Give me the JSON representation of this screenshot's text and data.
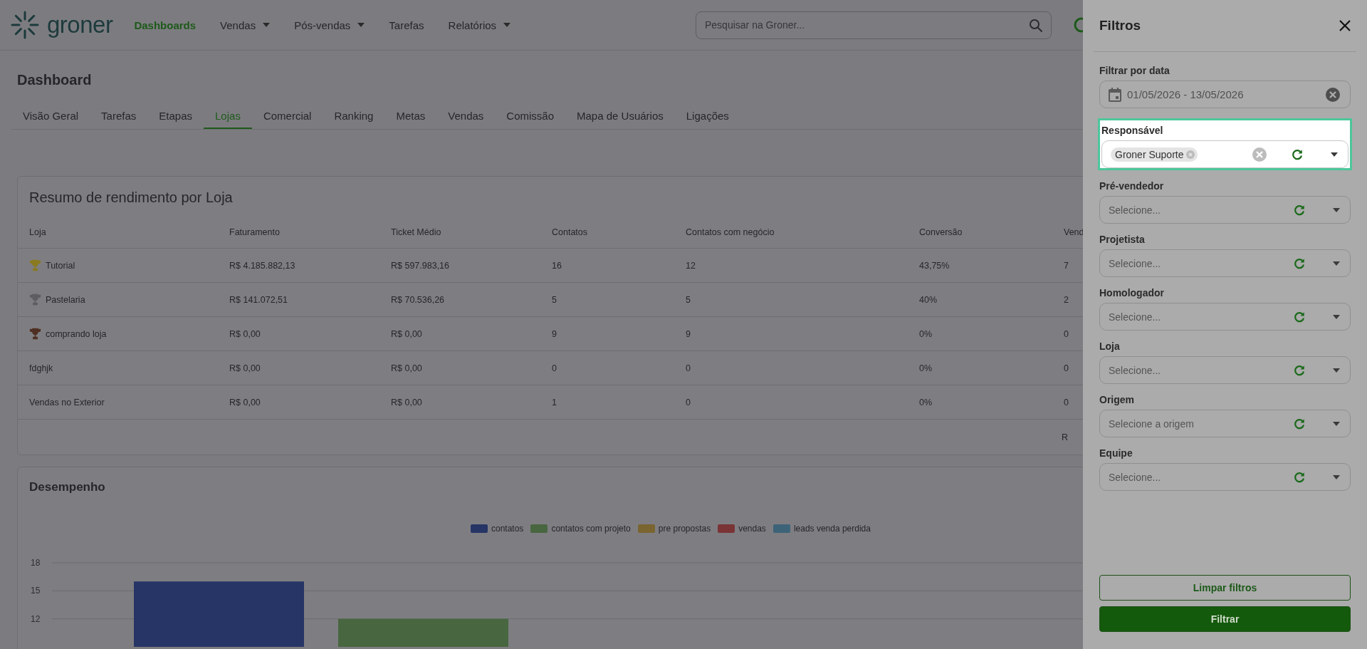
{
  "header": {
    "logo_text": "groner",
    "nav": [
      {
        "label": "Dashboards",
        "selected": true,
        "dropdown": false
      },
      {
        "label": "Vendas",
        "selected": false,
        "dropdown": true
      },
      {
        "label": "Pós-vendas",
        "selected": false,
        "dropdown": true
      },
      {
        "label": "Tarefas",
        "selected": false,
        "dropdown": false
      },
      {
        "label": "Relatórios",
        "selected": false,
        "dropdown": true
      }
    ],
    "search": {
      "placeholder": "Pesquisar na Groner..."
    }
  },
  "page_title": "Dashboard",
  "tabs": [
    {
      "label": "Visão Geral",
      "selected": false
    },
    {
      "label": "Tarefas",
      "selected": false
    },
    {
      "label": "Etapas",
      "selected": false
    },
    {
      "label": "Lojas",
      "selected": true
    },
    {
      "label": "Comercial",
      "selected": false
    },
    {
      "label": "Ranking",
      "selected": false
    },
    {
      "label": "Metas",
      "selected": false
    },
    {
      "label": "Vendas",
      "selected": false
    },
    {
      "label": "Comissão",
      "selected": false
    },
    {
      "label": "Mapa de Usuários",
      "selected": false
    },
    {
      "label": "Ligações",
      "selected": false
    }
  ],
  "summary_table": {
    "title": "Resumo de rendimento por Loja",
    "columns": [
      "Loja",
      "Faturamento",
      "Ticket Médio",
      "Contatos",
      "Contatos com negócio",
      "Conversão",
      "Vend"
    ],
    "rows": [
      {
        "color": "#8a7a20",
        "cells": [
          "Tutorial",
          "R$ 4.185.882,13",
          "R$ 597.983,16",
          "16",
          "12",
          "43,75%",
          "7"
        ]
      },
      {
        "color": "#5e5e62",
        "cells": [
          "Pastelaria",
          "R$ 141.072,51",
          "R$ 70.536,26",
          "5",
          "5",
          "40%",
          "2"
        ]
      },
      {
        "color": "#4e2f22",
        "cells": [
          "comprando loja",
          "R$ 0,00",
          "R$ 0,00",
          "9",
          "9",
          "0%",
          "0"
        ]
      },
      {
        "cells": [
          "fdghjk",
          "R$ 0,00",
          "R$ 0,00",
          "0",
          "0",
          "0%",
          "0"
        ]
      },
      {
        "cells": [
          "Vendas no Exterior",
          "R$ 0,00",
          "R$ 0,00",
          "1",
          "0",
          "0%",
          "0"
        ]
      }
    ],
    "footer_text": "R"
  },
  "performance": {
    "title": "Desempenho",
    "chart_data": {
      "type": "bar",
      "yticks": [
        12,
        15,
        18
      ],
      "ylim": [
        9,
        18
      ],
      "grid": true,
      "series": [
        {
          "name": "contatos",
          "color": "#263565",
          "values": [
            16
          ]
        },
        {
          "name": "contatos com projeto",
          "color": "#486640",
          "values": [
            12
          ]
        },
        {
          "name": "pre propostas",
          "color": "#7a6530",
          "values": [
            null
          ]
        },
        {
          "name": "vendas",
          "color": "#7a3436",
          "values": [
            null
          ]
        },
        {
          "name": "leads venda perdida",
          "color": "#3d6378",
          "values": [
            null
          ]
        }
      ]
    }
  },
  "drawer": {
    "title": "Filtros",
    "filters": [
      {
        "kind": "date",
        "label": "Filtrar por data",
        "value": "01/05/2026 - 13/05/2026",
        "focused": false
      },
      {
        "kind": "select",
        "label": "Responsável",
        "chips": [
          "Groner Suporte"
        ],
        "clearable": true,
        "focused": true
      },
      {
        "kind": "select",
        "label": "Pré-vendedor",
        "placeholder": "Selecione...",
        "focused": false
      },
      {
        "kind": "select",
        "label": "Projetista",
        "placeholder": "Selecione...",
        "focused": false
      },
      {
        "kind": "select",
        "label": "Homologador",
        "placeholder": "Selecione...",
        "focused": false
      },
      {
        "kind": "select",
        "label": "Loja",
        "placeholder": "Selecione...",
        "focused": false
      },
      {
        "kind": "select",
        "label": "Origem",
        "placeholder": "Selecione a origem",
        "focused": false
      },
      {
        "kind": "select",
        "label": "Equipe",
        "placeholder": "Selecione...",
        "focused": false
      }
    ],
    "buttons": [
      {
        "label": "Limpar filtros",
        "kind": "outline"
      },
      {
        "label": "Filtrar",
        "kind": "primary"
      }
    ]
  }
}
